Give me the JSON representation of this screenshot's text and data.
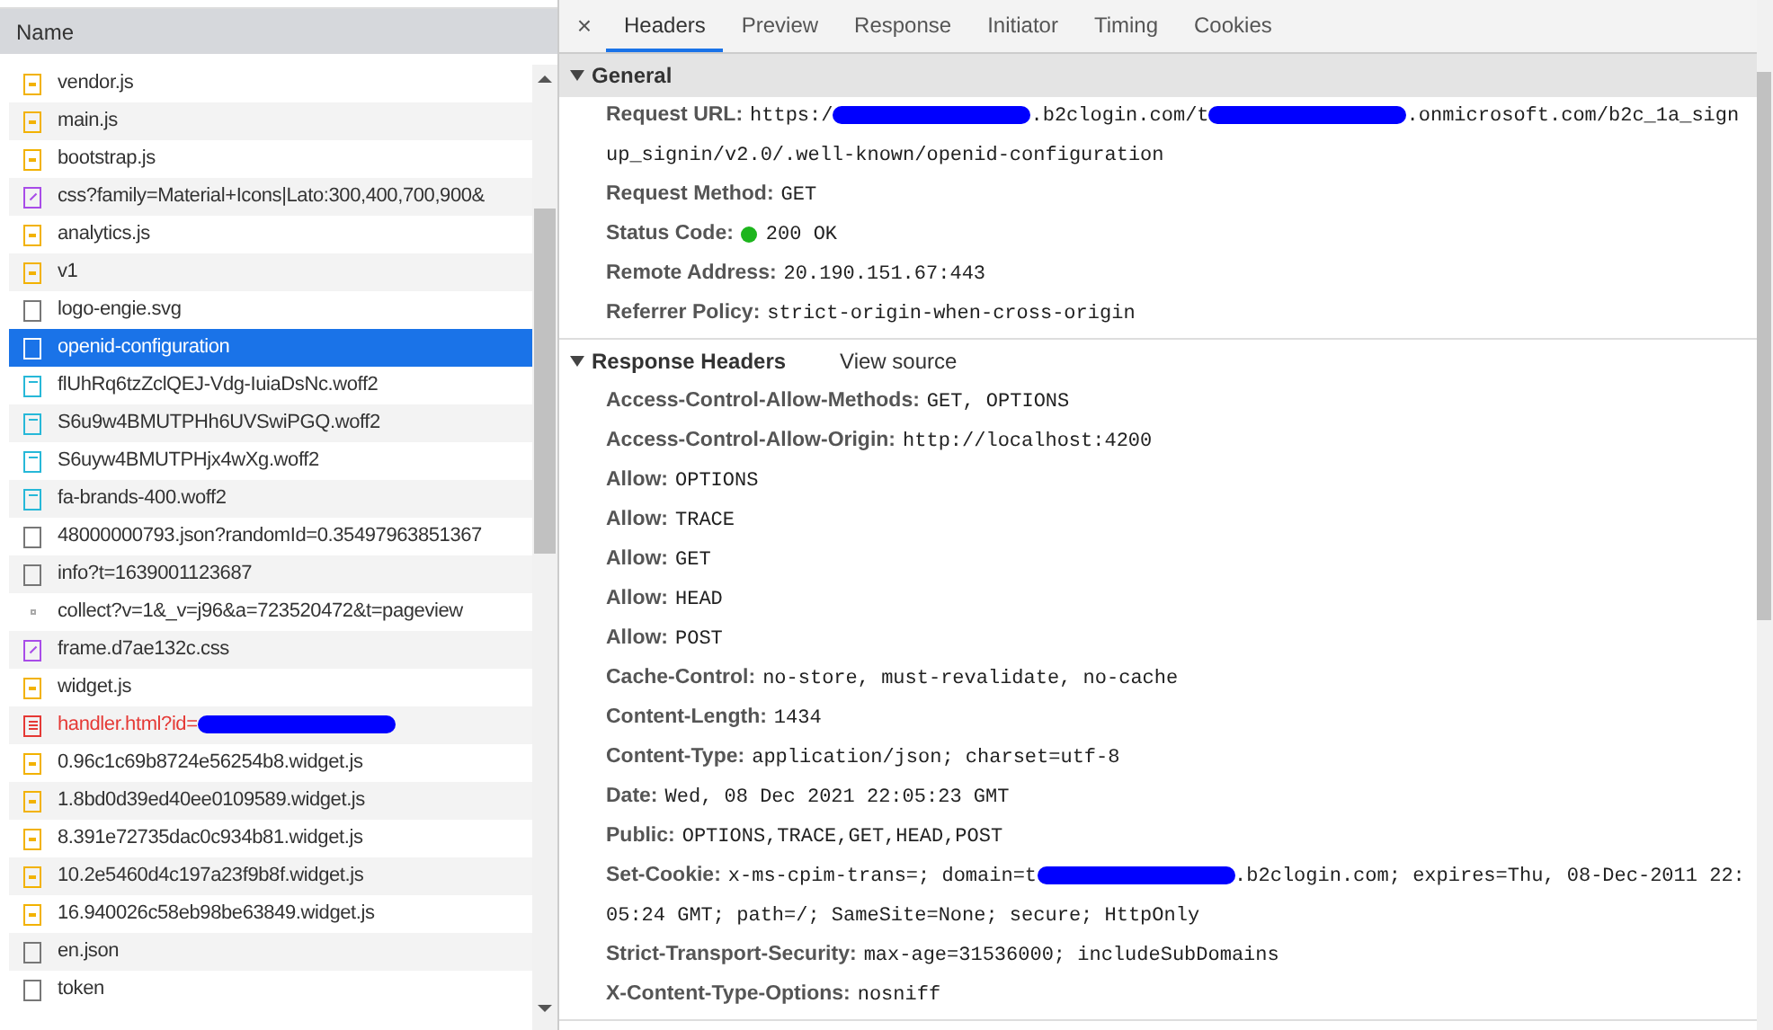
{
  "request_list": {
    "column_header": "Name",
    "rows": [
      {
        "kind": "script",
        "name": [
          {
            "kind": "text",
            "text": "vendor.js"
          }
        ],
        "selected": false,
        "error": false
      },
      {
        "kind": "script",
        "name": [
          {
            "kind": "text",
            "text": "main.js"
          }
        ],
        "selected": false,
        "error": false
      },
      {
        "kind": "script",
        "name": [
          {
            "kind": "text",
            "text": "bootstrap.js"
          }
        ],
        "selected": false,
        "error": false
      },
      {
        "kind": "stylesheet",
        "name": [
          {
            "kind": "text",
            "text": "css?family=Material+Icons|Lato:300,400,700,900&"
          }
        ],
        "selected": false,
        "error": false
      },
      {
        "kind": "script",
        "name": [
          {
            "kind": "text",
            "text": "analytics.js"
          }
        ],
        "selected": false,
        "error": false
      },
      {
        "kind": "script",
        "name": [
          {
            "kind": "text",
            "text": "v1"
          }
        ],
        "selected": false,
        "error": false
      },
      {
        "kind": "document",
        "name": [
          {
            "kind": "text",
            "text": "logo-engie.svg"
          }
        ],
        "selected": false,
        "error": false
      },
      {
        "kind": "document",
        "name": [
          {
            "kind": "text",
            "text": "openid-configuration"
          }
        ],
        "selected": true,
        "error": false
      },
      {
        "kind": "font",
        "name": [
          {
            "kind": "text",
            "text": "flUhRq6tzZclQEJ-Vdg-IuiaDsNc.woff2"
          }
        ],
        "selected": false,
        "error": false
      },
      {
        "kind": "font",
        "name": [
          {
            "kind": "text",
            "text": "S6u9w4BMUTPHh6UVSwiPGQ.woff2"
          }
        ],
        "selected": false,
        "error": false
      },
      {
        "kind": "font",
        "name": [
          {
            "kind": "text",
            "text": "S6uyw4BMUTPHjx4wXg.woff2"
          }
        ],
        "selected": false,
        "error": false
      },
      {
        "kind": "font",
        "name": [
          {
            "kind": "text",
            "text": "fa-brands-400.woff2"
          }
        ],
        "selected": false,
        "error": false
      },
      {
        "kind": "document",
        "name": [
          {
            "kind": "text",
            "text": "48000000793.json?randomId=0.35497963851367"
          }
        ],
        "selected": false,
        "error": false
      },
      {
        "kind": "document",
        "name": [
          {
            "kind": "text",
            "text": "info?t=1639001123687"
          }
        ],
        "selected": false,
        "error": false
      },
      {
        "kind": "other",
        "name": [
          {
            "kind": "text",
            "text": "collect?v=1&_v=j96&a=723520472&t=pageview"
          }
        ],
        "selected": false,
        "error": false
      },
      {
        "kind": "stylesheet",
        "name": [
          {
            "kind": "text",
            "text": "frame.d7ae132c.css"
          }
        ],
        "selected": false,
        "error": false
      },
      {
        "kind": "script",
        "name": [
          {
            "kind": "text",
            "text": "widget.js"
          }
        ],
        "selected": false,
        "error": false
      },
      {
        "kind": "html",
        "name": [
          {
            "kind": "text",
            "text": "handler.html?id="
          },
          {
            "kind": "redacted"
          }
        ],
        "selected": false,
        "error": true
      },
      {
        "kind": "script",
        "name": [
          {
            "kind": "text",
            "text": "0.96c1c69b8724e56254b8.widget.js"
          }
        ],
        "selected": false,
        "error": false
      },
      {
        "kind": "script",
        "name": [
          {
            "kind": "text",
            "text": "1.8bd0d39ed40ee0109589.widget.js"
          }
        ],
        "selected": false,
        "error": false
      },
      {
        "kind": "script",
        "name": [
          {
            "kind": "text",
            "text": "8.391e72735dac0c934b81.widget.js"
          }
        ],
        "selected": false,
        "error": false
      },
      {
        "kind": "script",
        "name": [
          {
            "kind": "text",
            "text": "10.2e5460d4c197a23f9b8f.widget.js"
          }
        ],
        "selected": false,
        "error": false
      },
      {
        "kind": "script",
        "name": [
          {
            "kind": "text",
            "text": "16.940026c58eb98be63849.widget.js"
          }
        ],
        "selected": false,
        "error": false
      },
      {
        "kind": "document",
        "name": [
          {
            "kind": "text",
            "text": "en.json"
          }
        ],
        "selected": false,
        "error": false
      },
      {
        "kind": "document",
        "name": [
          {
            "kind": "text",
            "text": "token"
          }
        ],
        "selected": false,
        "error": false
      }
    ]
  },
  "details": {
    "close": "×",
    "tabs": [
      {
        "label": "Headers",
        "selected": true
      },
      {
        "label": "Preview",
        "selected": false
      },
      {
        "label": "Response",
        "selected": false
      },
      {
        "label": "Initiator",
        "selected": false
      },
      {
        "label": "Timing",
        "selected": false
      },
      {
        "label": "Cookies",
        "selected": false
      }
    ],
    "sections": [
      {
        "title": "General",
        "expanded": true,
        "shaded": true,
        "fields": [
          {
            "label": "Request URL:",
            "value": [
              {
                "kind": "text",
                "text": "https:/"
              },
              {
                "kind": "redacted"
              },
              {
                "kind": "text",
                "text": ".b2clogin.com/t"
              },
              {
                "kind": "redacted"
              },
              {
                "kind": "text",
                "text": ".onmicrosoft.com/b2c_1a_signup_signin/v2.0/.well-known/openid-configuration"
              }
            ]
          },
          {
            "label": "Request Method:",
            "value": [
              {
                "kind": "text",
                "text": "GET"
              }
            ]
          },
          {
            "label": "Status Code:",
            "value": [
              {
                "kind": "status-dot",
                "color": "#1db51d"
              },
              {
                "kind": "text",
                "text": "200 OK"
              }
            ]
          },
          {
            "label": "Remote Address:",
            "value": [
              {
                "kind": "text",
                "text": "20.190.151.67:443"
              }
            ]
          },
          {
            "label": "Referrer Policy:",
            "value": [
              {
                "kind": "text",
                "text": "strict-origin-when-cross-origin"
              }
            ]
          }
        ]
      },
      {
        "title": "Response Headers",
        "expanded": true,
        "shaded": false,
        "link": "View source",
        "fields": [
          {
            "label": "Access-Control-Allow-Methods:",
            "value": [
              {
                "kind": "text",
                "text": "GET, OPTIONS"
              }
            ]
          },
          {
            "label": "Access-Control-Allow-Origin:",
            "value": [
              {
                "kind": "text",
                "text": "http://localhost:4200"
              }
            ]
          },
          {
            "label": "Allow:",
            "value": [
              {
                "kind": "text",
                "text": "OPTIONS"
              }
            ]
          },
          {
            "label": "Allow:",
            "value": [
              {
                "kind": "text",
                "text": "TRACE"
              }
            ]
          },
          {
            "label": "Allow:",
            "value": [
              {
                "kind": "text",
                "text": "GET"
              }
            ]
          },
          {
            "label": "Allow:",
            "value": [
              {
                "kind": "text",
                "text": "HEAD"
              }
            ]
          },
          {
            "label": "Allow:",
            "value": [
              {
                "kind": "text",
                "text": "POST"
              }
            ]
          },
          {
            "label": "Cache-Control:",
            "value": [
              {
                "kind": "text",
                "text": "no-store, must-revalidate, no-cache"
              }
            ]
          },
          {
            "label": "Content-Length:",
            "value": [
              {
                "kind": "text",
                "text": "1434"
              }
            ]
          },
          {
            "label": "Content-Type:",
            "value": [
              {
                "kind": "text",
                "text": "application/json; charset=utf-8"
              }
            ]
          },
          {
            "label": "Date:",
            "value": [
              {
                "kind": "text",
                "text": "Wed, 08 Dec 2021 22:05:23 GMT"
              }
            ]
          },
          {
            "label": "Public:",
            "value": [
              {
                "kind": "text",
                "text": "OPTIONS,TRACE,GET,HEAD,POST"
              }
            ]
          },
          {
            "label": "Set-Cookie:",
            "value": [
              {
                "kind": "text",
                "text": "x-ms-cpim-trans=; domain=t"
              },
              {
                "kind": "redacted"
              },
              {
                "kind": "text",
                "text": ".b2clogin.com; expires=Thu, 08-Dec-2011 22:05:24 GMT; path=/; SameSite=None; secure; HttpOnly"
              }
            ]
          },
          {
            "label": "Strict-Transport-Security:",
            "value": [
              {
                "kind": "text",
                "text": "max-age=31536000; includeSubDomains"
              }
            ]
          },
          {
            "label": "X-Content-Type-Options:",
            "value": [
              {
                "kind": "text",
                "text": "nosniff"
              }
            ]
          }
        ]
      }
    ]
  }
}
